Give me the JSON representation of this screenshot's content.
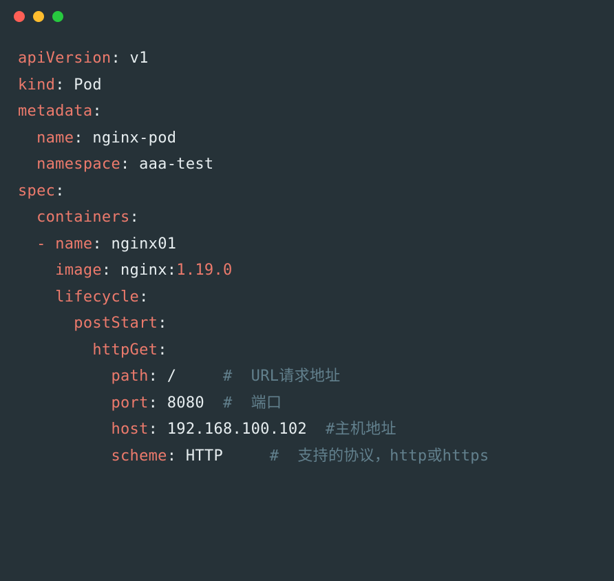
{
  "window": {
    "buttons": [
      "close",
      "minimize",
      "zoom"
    ]
  },
  "yaml": {
    "apiVersion_key": "apiVersion",
    "apiVersion_val": "v1",
    "kind_key": "kind",
    "kind_val": "Pod",
    "metadata_key": "metadata",
    "name_key": "name",
    "name_val": "nginx-pod",
    "namespace_key": "namespace",
    "namespace_val": "aaa-test",
    "spec_key": "spec",
    "containers_key": "containers",
    "dash": "-",
    "c_name_key": "name",
    "c_name_val": "nginx01",
    "image_key": "image",
    "image_repo": "nginx:",
    "image_tag": "1.19.0",
    "lifecycle_key": "lifecycle",
    "postStart_key": "postStart",
    "httpGet_key": "httpGet",
    "path_key": "path",
    "path_val": "/",
    "path_comment": "#  URL请求地址",
    "port_key": "port",
    "port_val": "8080",
    "port_comment": "#  端口",
    "host_key": "host",
    "host_val": "192.168.100.102",
    "host_comment": "#主机地址",
    "scheme_key": "scheme",
    "scheme_val": "HTTP",
    "scheme_comment": "#  支持的协议，http或https"
  }
}
